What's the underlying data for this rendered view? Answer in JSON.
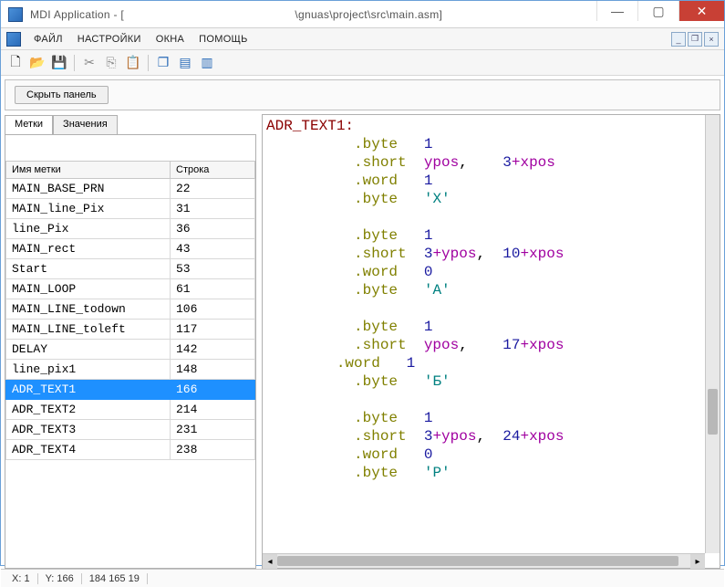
{
  "window": {
    "title_left": "MDI Application - [",
    "title_right": "\\gnuas\\project\\src\\main.asm]"
  },
  "menu": {
    "items": [
      "ФАЙЛ",
      "НАСТРОЙКИ",
      "ОКНА",
      "ПОМОЩЬ"
    ]
  },
  "panel": {
    "hide_label": "Скрыть панель"
  },
  "tabs": {
    "labels": "Метки",
    "values": "Значения"
  },
  "table": {
    "col_name": "Имя метки",
    "col_line": "Строка",
    "rows": [
      {
        "name": "MAIN_BASE_PRN",
        "line": "22"
      },
      {
        "name": "MAIN_line_Pix",
        "line": "31"
      },
      {
        "name": "line_Pix",
        "line": "36"
      },
      {
        "name": "MAIN_rect",
        "line": "43"
      },
      {
        "name": "Start",
        "line": "53"
      },
      {
        "name": "MAIN_LOOP",
        "line": "61"
      },
      {
        "name": "MAIN_LINE_todown",
        "line": "106"
      },
      {
        "name": "MAIN_LINE_toleft",
        "line": "117"
      },
      {
        "name": "DELAY",
        "line": "142"
      },
      {
        "name": "line_pix1",
        "line": "148"
      },
      {
        "name": "ADR_TEXT1",
        "line": "166",
        "selected": true
      },
      {
        "name": "ADR_TEXT2",
        "line": "214"
      },
      {
        "name": "ADR_TEXT3",
        "line": "231"
      },
      {
        "name": "ADR_TEXT4",
        "line": "238"
      }
    ]
  },
  "editor": {
    "label": "ADR_TEXT1:",
    "blocks": [
      {
        "byte": "1",
        "short_a": "ypos",
        "short_b": "3",
        "short_c": "xpos",
        "word": "1",
        "ch": "'Х'"
      },
      {
        "byte": "1",
        "short_a": "3",
        "short_aop": "+ypos",
        "short_b": "10",
        "short_c": "xpos",
        "word": "0",
        "ch": "'А'"
      },
      {
        "byte": "1",
        "short_a": "ypos",
        "short_b": "17",
        "short_c": "xpos",
        "word_outdent": true,
        "word": "1",
        "ch": "'Б'"
      },
      {
        "byte": "1",
        "short_a": "3",
        "short_aop": "+ypos",
        "short_b": "24",
        "short_c": "xpos",
        "word": "0",
        "ch": "'Р'",
        "truncate_ch": true
      }
    ]
  },
  "status": {
    "x": "X: 1",
    "y": "Y: 166",
    "rgb": "184 165 19"
  }
}
